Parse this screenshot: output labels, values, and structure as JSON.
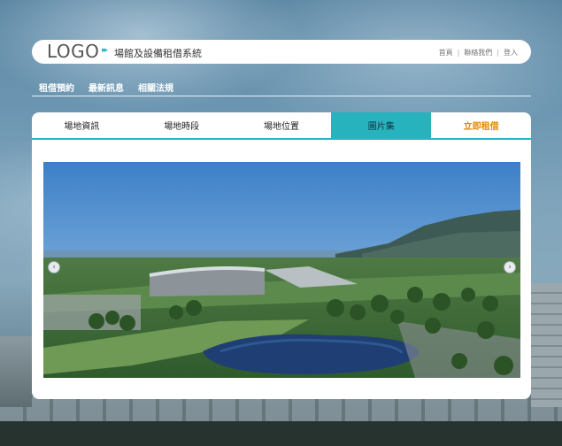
{
  "header": {
    "logo": "LOGO",
    "logo_arrows": "▸▸",
    "site_title": "場館及設備租借系統",
    "links": [
      "首頁",
      "聯絡我們",
      "登入"
    ],
    "separator": "|"
  },
  "nav": {
    "items": [
      "租借預約",
      "最新訊息",
      "相關法規"
    ]
  },
  "tabs": [
    {
      "label": "場地資訊"
    },
    {
      "label": "場地時段"
    },
    {
      "label": "場地位置"
    },
    {
      "label": "圖片集"
    },
    {
      "label": "立即租借"
    }
  ],
  "gallery": {
    "prev_glyph": "‹",
    "next_glyph": "›"
  },
  "colors": {
    "accent": "#29b6c4",
    "active_tab": "#27b3be",
    "cta": "#e08a00"
  }
}
